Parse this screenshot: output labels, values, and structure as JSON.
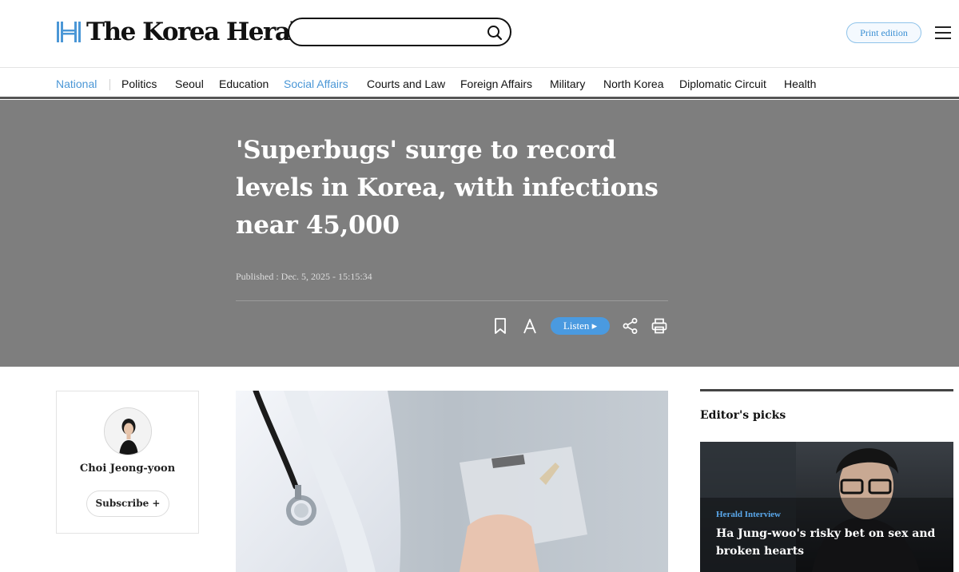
{
  "header": {
    "logo_text": "The Korea Herald",
    "search": {
      "value": "",
      "placeholder": ""
    },
    "print_edition_label": "Print edition"
  },
  "nav": {
    "items": [
      {
        "label": "National"
      },
      {
        "label": "Politics"
      },
      {
        "label": "Seoul"
      },
      {
        "label": "Education"
      },
      {
        "label": "Social Affairs"
      },
      {
        "label": "Courts and Law"
      },
      {
        "label": "Foreign Affairs"
      },
      {
        "label": "Military"
      },
      {
        "label": "North Korea"
      },
      {
        "label": "Diplomatic Circuit"
      },
      {
        "label": "Health"
      }
    ]
  },
  "article": {
    "headline": "'Superbugs' surge to record levels in Korea, with infections near 45,000",
    "published": "Published : Dec. 5, 2025 - 15:15:34",
    "tools": {
      "listen_label": "Listen ▸",
      "icons": [
        "bookmark-icon",
        "font-size-icon",
        "share-icon",
        "print-icon"
      ]
    },
    "author": {
      "name": "Choi Jeong-yoon",
      "subscribe_label": "Subscribe +"
    }
  },
  "sidebar": {
    "title": "Editor's picks",
    "pick": {
      "category": "Herald Interview",
      "title": "Ha Jung-woo's risky bet on sex and broken hearts"
    }
  },
  "colors": {
    "accent": "#4b97d6",
    "hero_background": "#7e7e7e",
    "listen_button": "#4a9ae0"
  }
}
